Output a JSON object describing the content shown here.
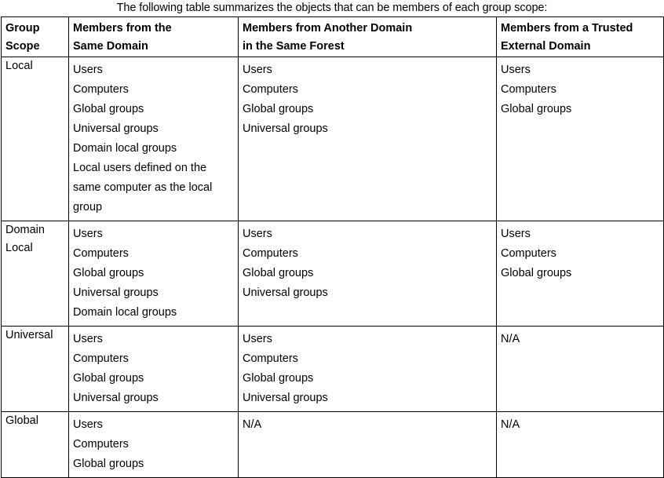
{
  "caption": "The following table summarizes the objects that can be members of each group scope:",
  "table": {
    "headers": [
      {
        "lines": [
          "Group",
          "Scope"
        ]
      },
      {
        "lines": [
          "Members from the",
          "Same Domain"
        ]
      },
      {
        "lines": [
          "Members from Another Domain",
          "in the Same Forest"
        ]
      },
      {
        "lines": [
          "Members from a Trusted",
          "External Domain"
        ]
      }
    ],
    "rows": [
      {
        "scope": {
          "lines": [
            "Local"
          ]
        },
        "same_domain": [
          "Users",
          "Computers",
          "Global groups",
          "Universal groups",
          "Domain local groups",
          "Local users defined on the",
          "same computer as the local",
          "group"
        ],
        "another_domain_same_forest": [
          "Users",
          "Computers",
          "Global groups",
          "Universal groups"
        ],
        "trusted_external_domain": [
          "Users",
          "Computers",
          "Global groups"
        ]
      },
      {
        "scope": {
          "lines": [
            "Domain",
            "Local"
          ]
        },
        "same_domain": [
          "Users",
          "Computers",
          "Global groups",
          "Universal groups",
          "Domain local groups"
        ],
        "another_domain_same_forest": [
          "Users",
          "Computers",
          "Global groups",
          "Universal groups"
        ],
        "trusted_external_domain": [
          "Users",
          "Computers",
          "Global groups"
        ]
      },
      {
        "scope": {
          "lines": [
            "Universal"
          ]
        },
        "same_domain": [
          "Users",
          "Computers",
          "Global groups",
          "Universal groups"
        ],
        "another_domain_same_forest": [
          "Users",
          "Computers",
          "Global groups",
          "Universal groups"
        ],
        "trusted_external_domain": [
          "N/A"
        ]
      },
      {
        "scope": {
          "lines": [
            "Global"
          ]
        },
        "same_domain": [
          "Users",
          "Computers",
          "Global groups"
        ],
        "another_domain_same_forest": [
          "N/A"
        ],
        "trusted_external_domain": [
          "N/A"
        ]
      }
    ]
  },
  "colors": {
    "text": "#000000",
    "border": "#000000",
    "background": "#ffffff"
  }
}
